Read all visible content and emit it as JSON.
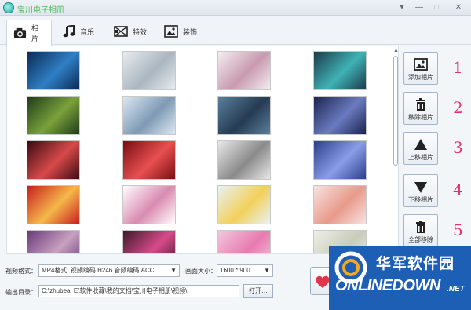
{
  "window": {
    "title": "宝川电子相册"
  },
  "tabs": [
    {
      "label": "相片",
      "icon": "camera-icon",
      "active": true
    },
    {
      "label": "音乐",
      "icon": "music-note-icon",
      "active": false
    },
    {
      "label": "特效",
      "icon": "film-clapper-icon",
      "active": false
    },
    {
      "label": "装饰",
      "icon": "picture-icon",
      "active": false
    }
  ],
  "side_buttons": [
    {
      "label": "添加相片",
      "icon": "add-image-icon",
      "number": "1"
    },
    {
      "label": "移除相片",
      "icon": "trash-icon",
      "number": "2"
    },
    {
      "label": "上移相片",
      "icon": "triangle-up-icon",
      "number": "3"
    },
    {
      "label": "下移相片",
      "icon": "triangle-down-icon",
      "number": "4"
    },
    {
      "label": "全部移除",
      "icon": "trash-all-icon",
      "number": "5"
    }
  ],
  "photos": [
    {
      "subject": "blue night scene",
      "colors": [
        "#0b2a55",
        "#2f7fc4"
      ]
    },
    {
      "subject": "white horses",
      "colors": [
        "#e7ecf0",
        "#aab6c0"
      ]
    },
    {
      "subject": "floral pastel card",
      "colors": [
        "#f4eef0",
        "#c89ab0"
      ]
    },
    {
      "subject": "fantasy girl teal",
      "colors": [
        "#1c3a4a",
        "#3fb2b5"
      ]
    },
    {
      "subject": "green fantasy figure",
      "colors": [
        "#1e3b1a",
        "#7aa23a"
      ]
    },
    {
      "subject": "snowy forest",
      "colors": [
        "#dde8f2",
        "#7e9ab5"
      ]
    },
    {
      "subject": "blue sea pier",
      "colors": [
        "#5b7f9c",
        "#253b52"
      ]
    },
    {
      "subject": "night mountain city",
      "colors": [
        "#1a2450",
        "#6b7bc0"
      ]
    },
    {
      "subject": "snowman christmas",
      "colors": [
        "#3a0a12",
        "#d84a4a"
      ]
    },
    {
      "subject": "roses and coffee",
      "colors": [
        "#7a0d12",
        "#e85050"
      ]
    },
    {
      "subject": "girl in white",
      "colors": [
        "#e8e8e8",
        "#8a8a8a"
      ]
    },
    {
      "subject": "blue hydrangea",
      "colors": [
        "#2a3f8a",
        "#8a9ee8"
      ]
    },
    {
      "subject": "2015 red greeting",
      "colors": [
        "#c81e1e",
        "#f5b84a"
      ]
    },
    {
      "subject": "anime girl",
      "colors": [
        "#ffffff",
        "#d98ab0"
      ]
    },
    {
      "subject": "easter eggs",
      "colors": [
        "#e8f2f6",
        "#f2d05a"
      ]
    },
    {
      "subject": "pink blossom trees",
      "colors": [
        "#f8e2e2",
        "#e89a8a"
      ]
    },
    {
      "subject": "purple flower girl",
      "colors": [
        "#6a3a7a",
        "#c8a0c0"
      ]
    },
    {
      "subject": "pink flowers",
      "colors": [
        "#3a1a2a",
        "#d84a8a"
      ]
    },
    {
      "subject": "pink bokeh girl",
      "colors": [
        "#f2c8dc",
        "#e87ab0"
      ]
    },
    {
      "subject": "pale field",
      "colors": [
        "#eef0e8",
        "#c8ccb8"
      ]
    }
  ],
  "settings": {
    "format_label": "视频格式：",
    "format_value": "MP4格式: 视频编码 H246 音频编码 ACC",
    "size_label": "画面大小：",
    "size_value": "1600 * 900",
    "output_label": "输出目录：",
    "output_value": "C:\\zhubea_E\\软件收藏\\我的文档\\宝川电子相册\\视频\\",
    "open_button": "打开…"
  },
  "watermark": {
    "cn": "华军软件园",
    "en": "ONLINEDOWN",
    "suffix": ".NET"
  },
  "colors": {
    "accent_number": "#e0336a",
    "title_green": "#4bbd5a",
    "watermark_blue": "#1d5fb5"
  }
}
